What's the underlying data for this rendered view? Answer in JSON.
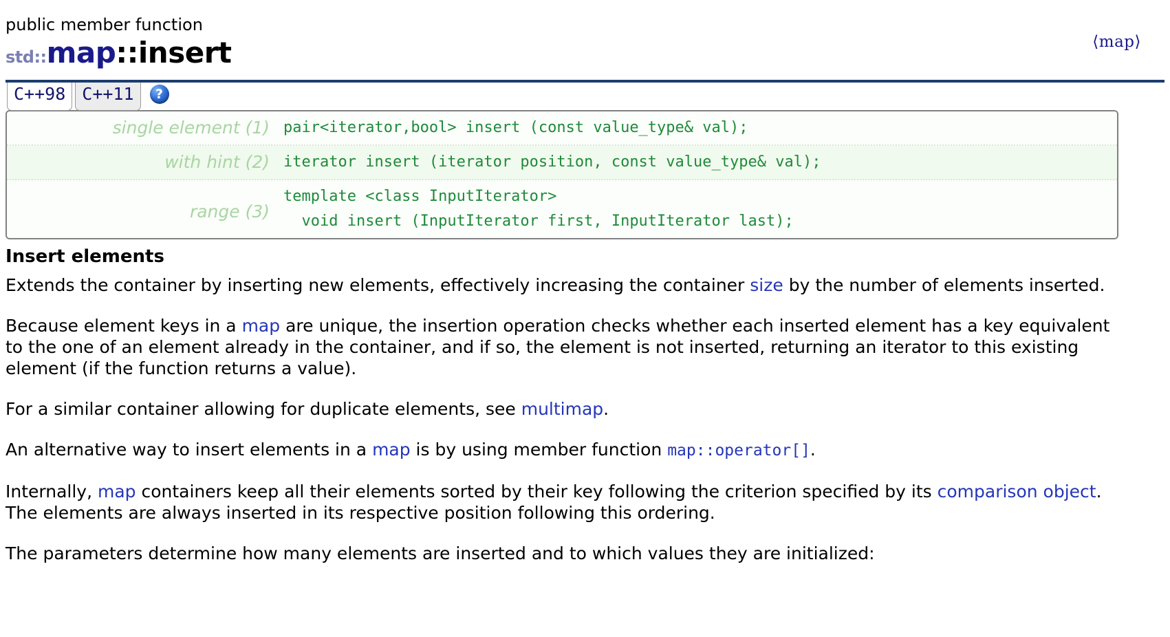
{
  "header": {
    "kind": "public member function",
    "namespace": "std::",
    "class_name": "map",
    "separator": "::",
    "function_name": "insert",
    "include_header": "⟨map⟩"
  },
  "tabs": [
    {
      "label": "C++98",
      "active": true
    },
    {
      "label": "C++11",
      "active": false
    }
  ],
  "help": {
    "glyph": "?"
  },
  "signatures": [
    {
      "label": "single element (1)",
      "code": "pair<iterator,bool> insert (const value_type& val);"
    },
    {
      "label": "with hint (2)",
      "code": "iterator insert (iterator position, const value_type& val);"
    },
    {
      "label": "range (3)",
      "code": "template <class InputIterator>\n  void insert (InputIterator first, InputIterator last);"
    }
  ],
  "section": {
    "heading": "Insert elements"
  },
  "paragraphs": {
    "p1_a": "Extends the container by inserting new elements, effectively increasing the container ",
    "p1_link": "size",
    "p1_b": " by the number of elements inserted.",
    "p2_a": "Because element keys in a ",
    "p2_link": "map",
    "p2_b": " are unique, the insertion operation checks whether each inserted element has a key equivalent to the one of an element already in the container, and if so, the element is not inserted, returning an iterator to this existing element (if the function returns a value).",
    "p3_a": "For a similar container allowing for duplicate elements, see ",
    "p3_link": "multimap",
    "p3_b": ".",
    "p4_a": "An alternative way to insert elements in a ",
    "p4_link1": "map",
    "p4_b": " is by using member function ",
    "p4_link2": "map::operator[]",
    "p4_c": ".",
    "p5_a": "Internally, ",
    "p5_link1": "map",
    "p5_b": " containers keep all their elements sorted by their key following the criterion specified by its ",
    "p5_link2": "comparison object",
    "p5_c": ". The elements are always inserted in its respective position following this ordering.",
    "p6": "The parameters determine how many elements are inserted and to which values they are initialized:"
  },
  "colors": {
    "link": "#2436b8",
    "class_title": "#1a1a8c",
    "namespace": "#7a7fb3",
    "rule": "#1b3c6e",
    "sig_code": "#1f8a3b",
    "sig_label": "#a8d5a2",
    "sig_bg": "#f7fcf5",
    "sig_border": "#808080",
    "help_icon": "#2f6fd6"
  }
}
